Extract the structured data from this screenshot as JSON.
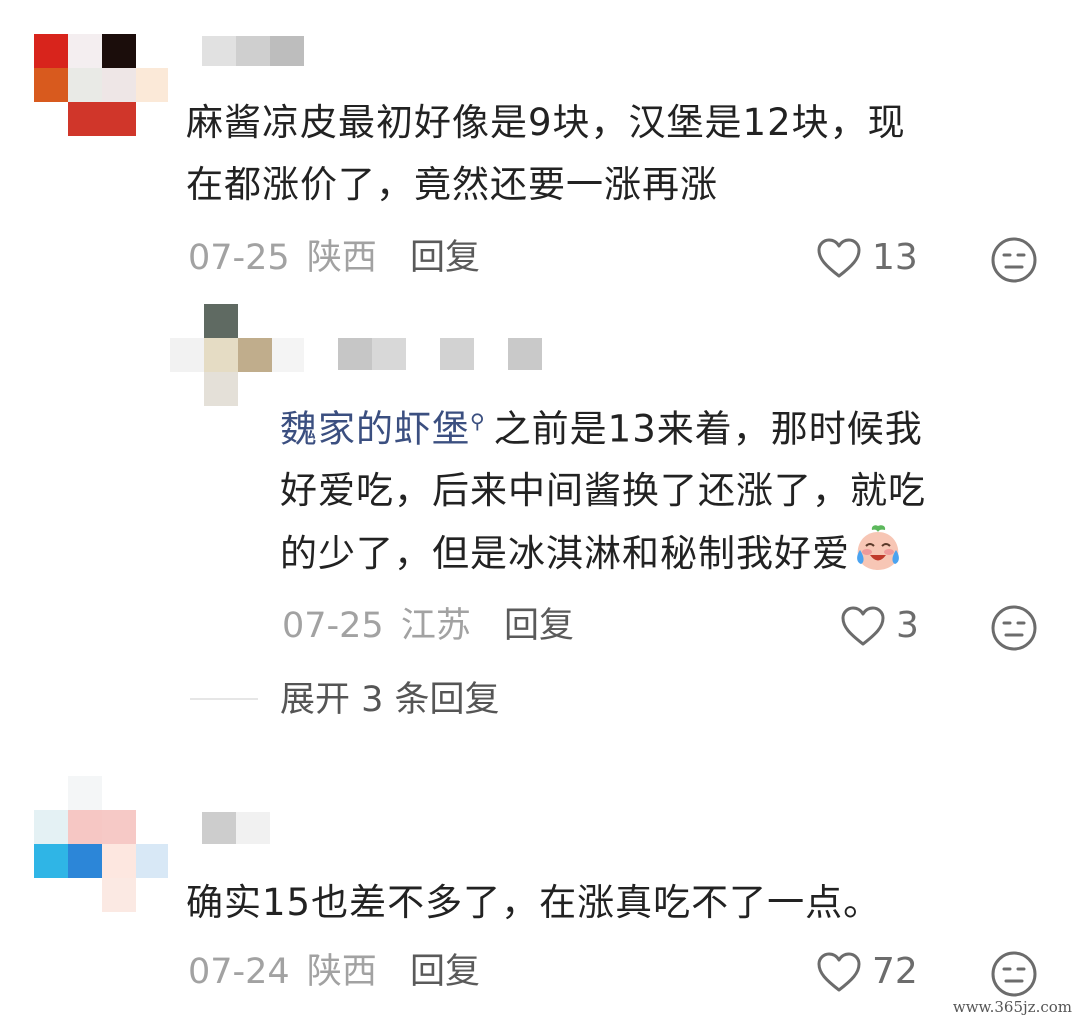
{
  "comments": [
    {
      "text_lines": [
        "麻酱凉皮最初好像是9块，汉堡是12块，现",
        "在都涨价了，竟然还要一涨再涨"
      ],
      "date": "07-25",
      "location": "陕西",
      "reply_label": "回复",
      "likes": "13",
      "like_icon": "heart-outline-icon",
      "dislike_icon": "neutral-face-icon"
    },
    {
      "mention": "魏家的虾堡",
      "mention_icon": "search-icon",
      "text_lines": [
        "之前是13来着，那时候我",
        "好爱吃，后来中间酱换了还涨了，就吃",
        "的少了，但是冰淇淋和秘制我好爱"
      ],
      "emoji": "crying-laughing-peach-emoji",
      "date": "07-25",
      "location": "江苏",
      "reply_label": "回复",
      "likes": "3",
      "like_icon": "heart-outline-icon",
      "dislike_icon": "neutral-face-icon"
    },
    {
      "text_lines": [
        "确实15也差不多了，在涨真吃不了一点。"
      ],
      "date": "07-24",
      "location": "陕西",
      "reply_label": "回复",
      "likes": "72",
      "like_icon": "heart-outline-icon",
      "dislike_icon": "neutral-face-icon"
    }
  ],
  "expand_replies": "展开 3 条回复",
  "watermark": "www.365jz.com",
  "colors": {
    "text": "#222222",
    "meta": "#a2a2a2",
    "mention": "#3b4f80",
    "icon": "#6c6c6c"
  }
}
